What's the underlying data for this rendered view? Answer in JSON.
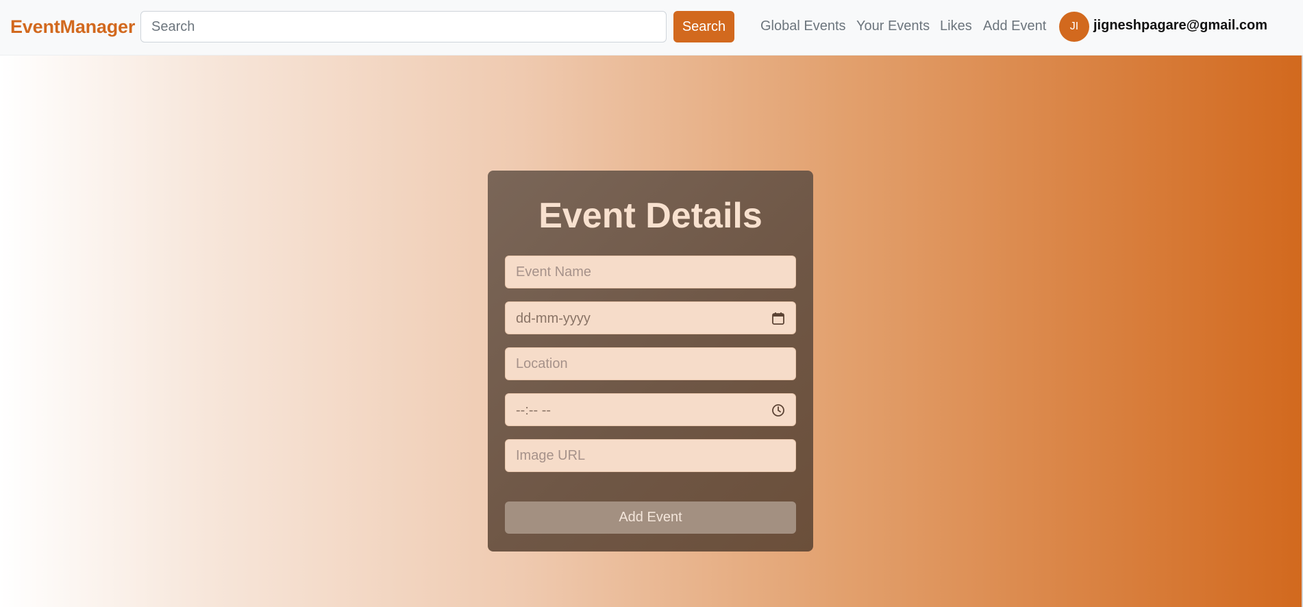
{
  "navbar": {
    "brand": "EventManager",
    "search_placeholder": "Search",
    "search_button": "Search",
    "links": [
      "Global Events",
      "Your Events",
      "Likes",
      "Add Event"
    ],
    "avatar_initials": "JI",
    "user_email": "jigneshpagare@gmail.com"
  },
  "form": {
    "title": "Event Details",
    "event_name_placeholder": "Event Name",
    "date_placeholder": "dd-mm-yyyy",
    "location_placeholder": "Location",
    "time_placeholder": "--:-- --",
    "image_url_placeholder": "Image URL",
    "submit_label": "Add Event"
  },
  "icons": {
    "date": "calendar-icon",
    "time": "clock-icon"
  },
  "colors": {
    "accent": "#d2691e",
    "navbar_bg": "#f8f9fa",
    "card_bg": "#6f5746",
    "title_text": "#f8e1cf",
    "field_bg": "#f6dcc9",
    "submit_bg": "#a39081"
  }
}
